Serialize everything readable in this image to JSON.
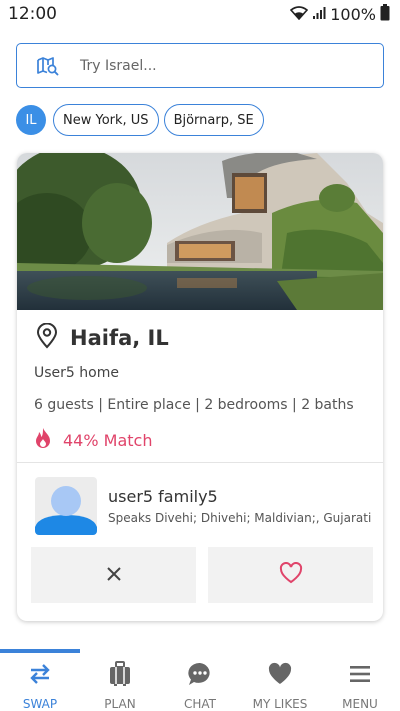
{
  "status_bar": {
    "time": "12:00",
    "battery": "100%"
  },
  "search": {
    "placeholder": "Try Israel..."
  },
  "chips": {
    "country": "IL",
    "locations": [
      "New York, US",
      "Björnarp, SE"
    ]
  },
  "listing": {
    "location": "Haifa, IL",
    "home_name": "User5 home",
    "details": "6 guests | Entire place | 2 bedrooms | 2 baths",
    "match": "44% Match",
    "owner": {
      "name": "user5 family5",
      "languages": "Speaks Divehi; Dhivehi; Maldivian;, Gujarati"
    }
  },
  "colors": {
    "accent": "#3b82d9",
    "match": "#e0446a",
    "nav_icon": "#666666"
  },
  "nav": {
    "items": [
      {
        "label": "SWAP",
        "icon": "swap-icon",
        "active": true
      },
      {
        "label": "PLAN",
        "icon": "suitcase-icon",
        "active": false
      },
      {
        "label": "CHAT",
        "icon": "chat-icon",
        "active": false
      },
      {
        "label": "MY LIKES",
        "icon": "heart-icon",
        "active": false
      },
      {
        "label": "MENU",
        "icon": "menu-icon",
        "active": false
      }
    ]
  }
}
